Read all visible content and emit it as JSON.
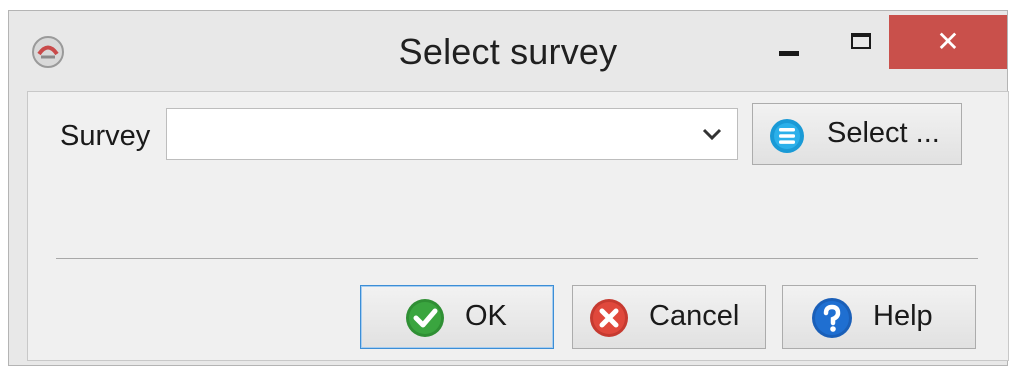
{
  "window": {
    "title": "Select survey",
    "close_glyph": "✕"
  },
  "form": {
    "survey_label": "Survey",
    "survey_value": "",
    "select_button_label": "Select ..."
  },
  "buttons": {
    "ok_label": "OK",
    "cancel_label": "Cancel",
    "help_label": "Help"
  },
  "icons": {
    "app": "app-logo-icon",
    "select": "list-icon",
    "ok": "checkmark-icon",
    "cancel": "cancel-x-icon",
    "help": "question-mark-icon"
  },
  "colors": {
    "close_button": "#c9504b",
    "ok_icon": "#3aa53f",
    "cancel_icon": "#e0483c",
    "help_icon": "#1f6fd1",
    "select_icon": "#1a9ad6",
    "default_button_border": "#3c8ed6"
  }
}
